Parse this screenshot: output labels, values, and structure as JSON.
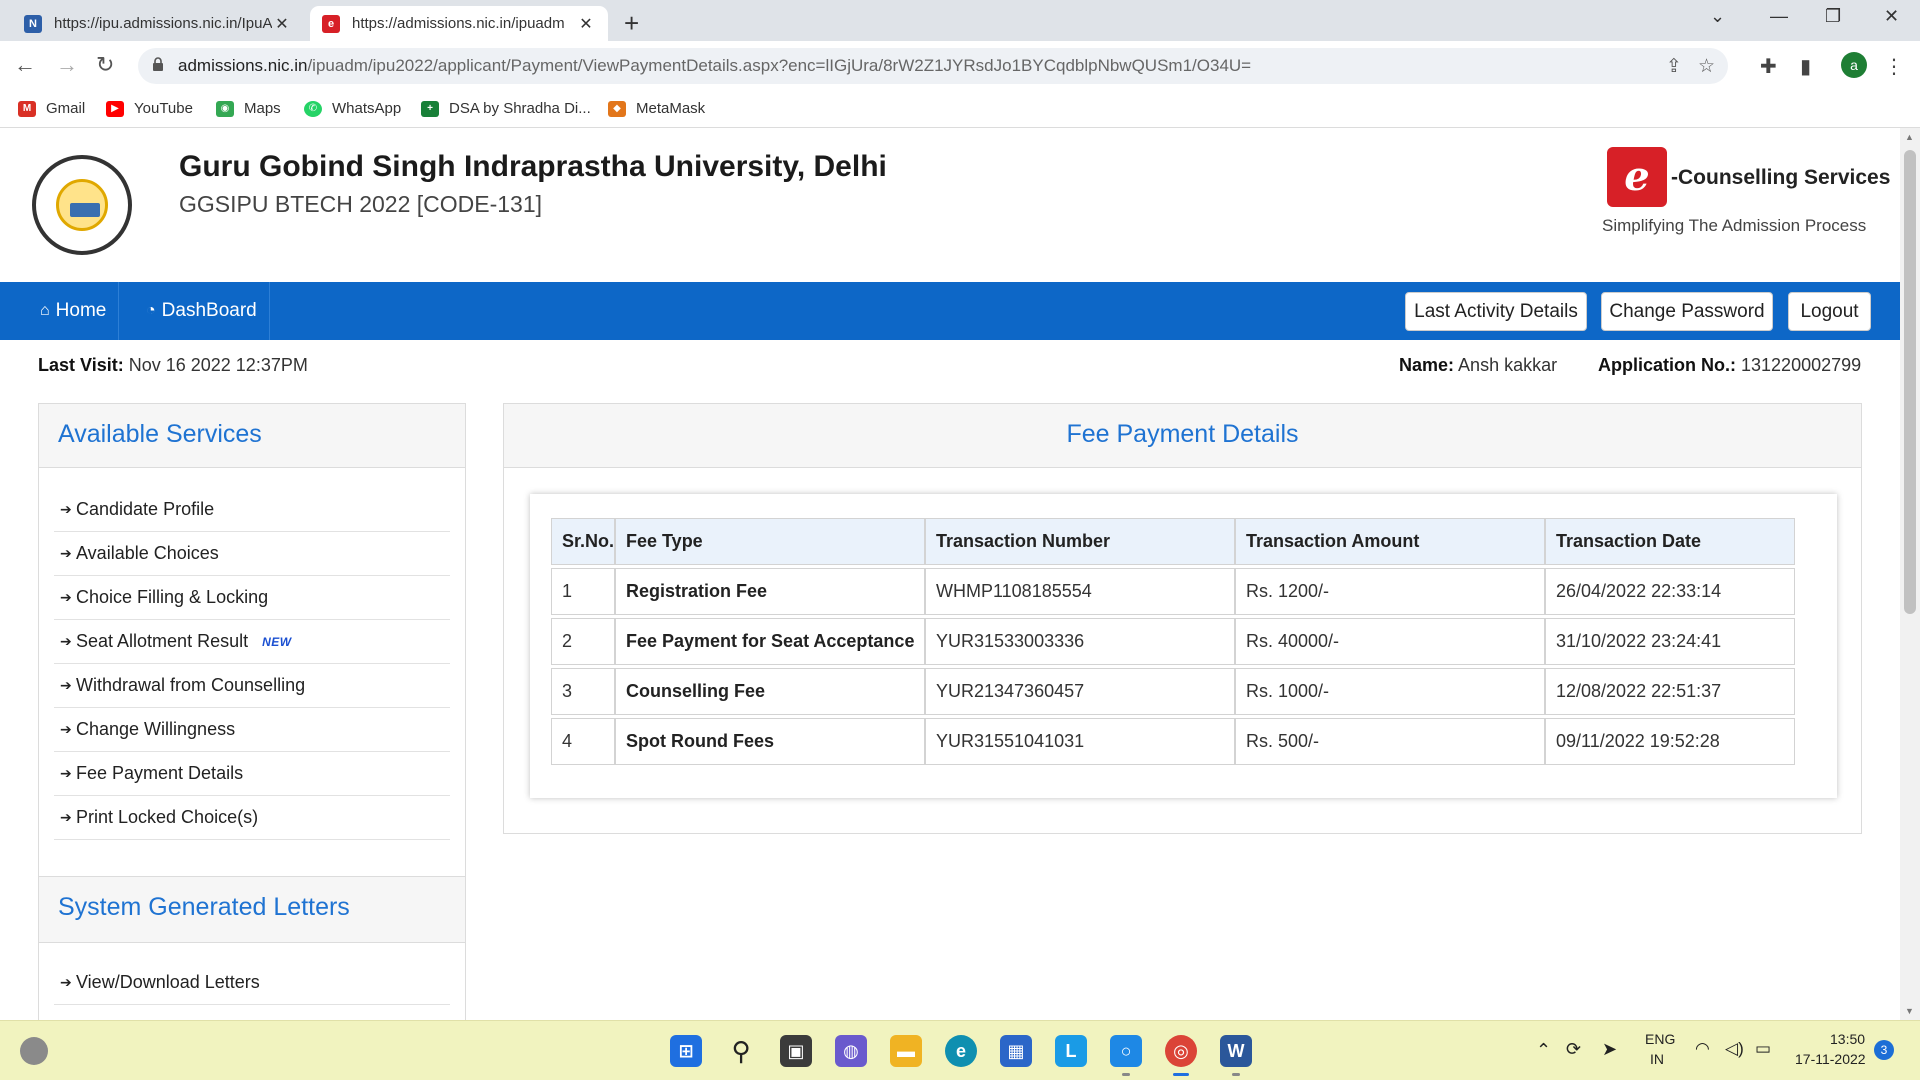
{
  "browser": {
    "tabs": [
      {
        "title": "https://ipu.admissions.nic.in/IpuA",
        "favicon": "nic-favicon-icon"
      },
      {
        "title": "https://admissions.nic.in/ipuadm",
        "favicon": "ecounselling-favicon-icon"
      }
    ],
    "url_host": "admissions.nic.in",
    "url_path": "/ipuadm/ipu2022/applicant/Payment/ViewPaymentDetails.aspx?enc=lIGjUra/8rW2Z1JYRsdJo1BYCqdblpNbwQUSm1/O34U=",
    "profile_initial": "a",
    "bookmarks": [
      {
        "label": "Gmail",
        "icon": "gmail-icon",
        "color": "#d93025"
      },
      {
        "label": "YouTube",
        "icon": "youtube-icon",
        "color": "#ff0000"
      },
      {
        "label": "Maps",
        "icon": "maps-icon",
        "color": "#34a853"
      },
      {
        "label": "WhatsApp",
        "icon": "whatsapp-icon",
        "color": "#25d366"
      },
      {
        "label": "DSA by Shradha Di...",
        "icon": "sheets-icon",
        "color": "#188038"
      },
      {
        "label": "MetaMask",
        "icon": "metamask-icon",
        "color": "#e2761b"
      }
    ]
  },
  "header": {
    "university": "Guru Gobind Singh Indraprastha University, Delhi",
    "subtitle": "GGSIPU BTECH 2022 [CODE-131]",
    "brand_letter": "e",
    "brand_title": "-Counselling Services",
    "brand_tagline": "Simplifying The Admission Process"
  },
  "nav": {
    "home": "Home",
    "dashboard": "DashBoard",
    "last_activity": "Last Activity Details",
    "change_password": "Change Password",
    "logout": "Logout"
  },
  "info": {
    "last_visit_label": "Last Visit:",
    "last_visit_value": "Nov 16 2022 12:37PM",
    "name_label": "Name:",
    "name_value": "Ansh kakkar",
    "appno_label": "Application No.:",
    "appno_value": "131220002799"
  },
  "services": {
    "title": "Available Services",
    "items": [
      {
        "label": "Candidate Profile"
      },
      {
        "label": "Available Choices"
      },
      {
        "label": "Choice Filling & Locking"
      },
      {
        "label": "Seat Allotment Result",
        "badge": "NEW"
      },
      {
        "label": "Withdrawal from Counselling"
      },
      {
        "label": "Change Willingness"
      },
      {
        "label": "Fee Payment Details"
      },
      {
        "label": "Print Locked Choice(s)"
      }
    ]
  },
  "letters": {
    "title": "System Generated Letters",
    "items": [
      {
        "label": "View/Download Letters"
      }
    ]
  },
  "fee": {
    "title": "Fee Payment Details",
    "columns": [
      "Sr.No.",
      "Fee Type",
      "Transaction Number",
      "Transaction Amount",
      "Transaction Date"
    ],
    "rows": [
      [
        "1",
        "Registration Fee",
        "WHMP1108185554",
        "Rs. 1200/-",
        "26/04/2022 22:33:14"
      ],
      [
        "2",
        "Fee Payment for Seat Acceptance",
        "YUR31533003336",
        "Rs. 40000/-",
        "31/10/2022 23:24:41"
      ],
      [
        "3",
        "Counselling Fee",
        "YUR21347360457",
        "Rs. 1000/-",
        "12/08/2022 22:51:37"
      ],
      [
        "4",
        "Spot Round Fees",
        "YUR31551041031",
        "Rs. 500/-",
        "09/11/2022 19:52:28"
      ]
    ]
  },
  "taskbar": {
    "lang": "ENG",
    "region": "IN",
    "time": "13:50",
    "date": "17-11-2022",
    "notifications": "3"
  }
}
